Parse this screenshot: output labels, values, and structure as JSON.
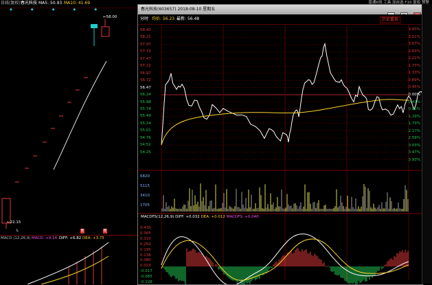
{
  "left_panel": {
    "header": {
      "period": "日线(复权)",
      "stock": "春光科技",
      "ma5": "MA5: 50.93",
      "ma10": "MA10: 41.69"
    },
    "high_label": "←58.00",
    "low_label": "←22.15",
    "markers": [
      "L",
      "B",
      "B"
    ],
    "macd": {
      "name": "MACD (12,26,9)",
      "macd": "MACD: +9.14",
      "diff": "DIFF: +6.82",
      "dea": "DEA: +3.75"
    }
  },
  "top_menu": [
    "普通K线",
    "工具",
    "加自选",
    "F10",
    "复权",
    "预警"
  ],
  "window": {
    "title": "春光科技(603657) 2018-08-10 星期五",
    "controls": [
      "_",
      "□",
      "×"
    ],
    "info": {
      "label": "分时",
      "avg": "均价: 56.23",
      "latest": "最新: 56.48",
      "history_button": "历史重现"
    },
    "price_axis": [
      "58.40",
      "58.21",
      "57.97",
      "57.72",
      "57.47",
      "57.22",
      "56.97",
      "56.72",
      "56.47",
      "56.24",
      "55.98",
      "55.74",
      "55.49",
      "55.24",
      "55.01",
      "54.76",
      "54.51",
      "54.25"
    ],
    "pct_axis": [
      "3.43%",
      "3.51%",
      "3.07%",
      "2.63%",
      "2.21%",
      "1.77%",
      "1.33%",
      "0.89%",
      "0.45%",
      "0.00%",
      "0.41%",
      "0.85%",
      "1.29%",
      "1.73%",
      "2.17%",
      "2.59%",
      "3.03%",
      "3.47%",
      "3.93%"
    ],
    "volume_axis": [
      "6820",
      "5115",
      "3410",
      "1705"
    ],
    "macd_label": {
      "name": "MACDFS(12,26,9)",
      "diff": "DIFF: +0.032",
      "dea": "DEA: +0.012",
      "macdfs": "MACDFS: +0.040"
    },
    "macd_axis": [
      "0.430",
      "0.365",
      "0.310",
      "0.250",
      "0.195",
      "0.138",
      "0.080",
      "0.023",
      "-0.017",
      "-0.065",
      "-0.128"
    ],
    "colors": {
      "up": "#e23a3a",
      "down": "#22cc55",
      "price_line": "#ffffff",
      "avg_line": "#ffd52e",
      "grid": "#6a0000"
    }
  }
}
